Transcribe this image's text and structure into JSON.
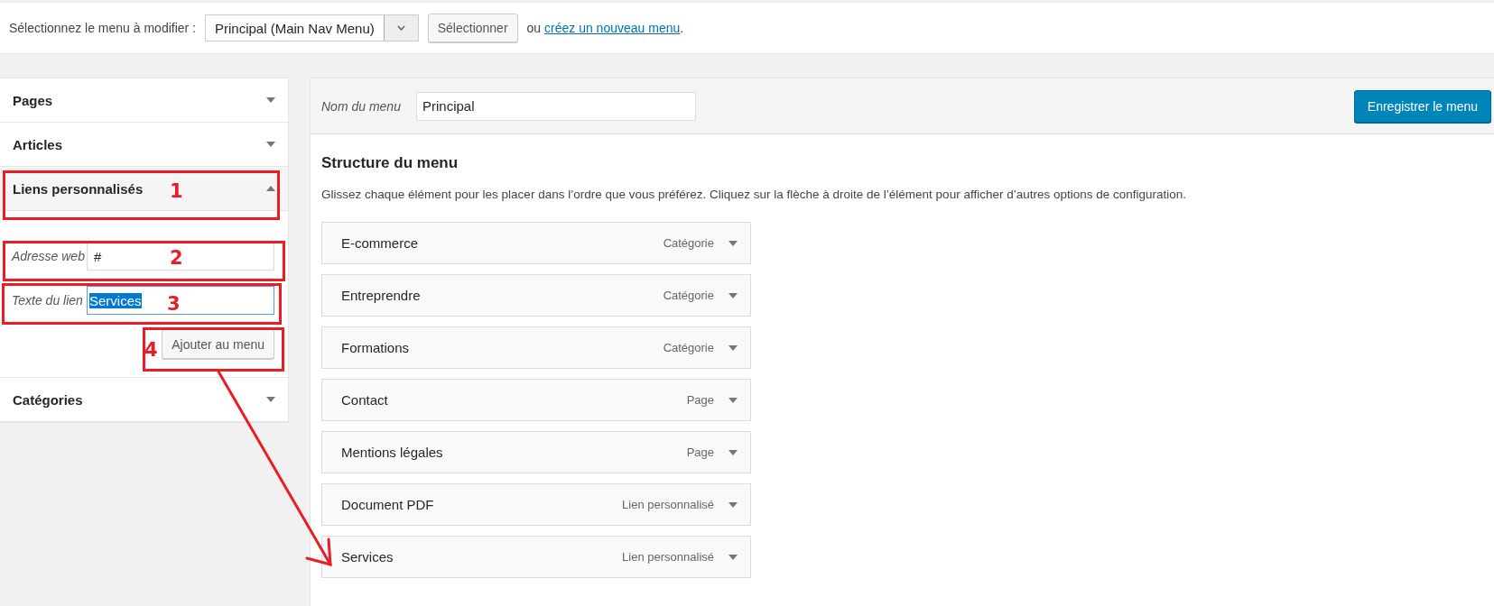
{
  "top_bar": {
    "label": "Sélectionnez le menu à modifier :",
    "select_value": "Principal (Main Nav Menu)",
    "select_button": "Sélectionner",
    "create_prefix": "ou",
    "create_link": "créez un nouveau menu",
    "create_suffix": "."
  },
  "sidebar": {
    "sections": [
      {
        "title": "Pages",
        "expanded": false
      },
      {
        "title": "Articles",
        "expanded": false
      },
      {
        "title": "Liens personnalisés",
        "expanded": true,
        "fields": [
          {
            "label": "Adresse web",
            "value": "#",
            "text_selected": false
          },
          {
            "label": "Texte du lien",
            "value": "Services",
            "text_selected": true
          }
        ],
        "button": "Ajouter au menu"
      },
      {
        "title": "Catégories",
        "expanded": false
      }
    ]
  },
  "editor": {
    "name_label": "Nom du menu",
    "name_value": "Principal",
    "save_button": "Enregistrer le menu",
    "heading": "Structure du menu",
    "description": "Glissez chaque élément pour les placer dans l’ordre que vous préférez. Cliquez sur la flèche à droite de l’élément pour afficher d’autres options de configuration.",
    "items": [
      {
        "title": "E-commerce",
        "type": "Catégorie"
      },
      {
        "title": "Entreprendre",
        "type": "Catégorie"
      },
      {
        "title": "Formations",
        "type": "Catégorie"
      },
      {
        "title": "Contact",
        "type": "Page"
      },
      {
        "title": "Mentions légales",
        "type": "Page"
      },
      {
        "title": "Document PDF",
        "type": "Lien personnalisé"
      },
      {
        "title": "Services",
        "type": "Lien personnalisé"
      }
    ]
  },
  "annotations": [
    {
      "number": "1"
    },
    {
      "number": "2"
    },
    {
      "number": "3"
    },
    {
      "number": "4"
    }
  ]
}
